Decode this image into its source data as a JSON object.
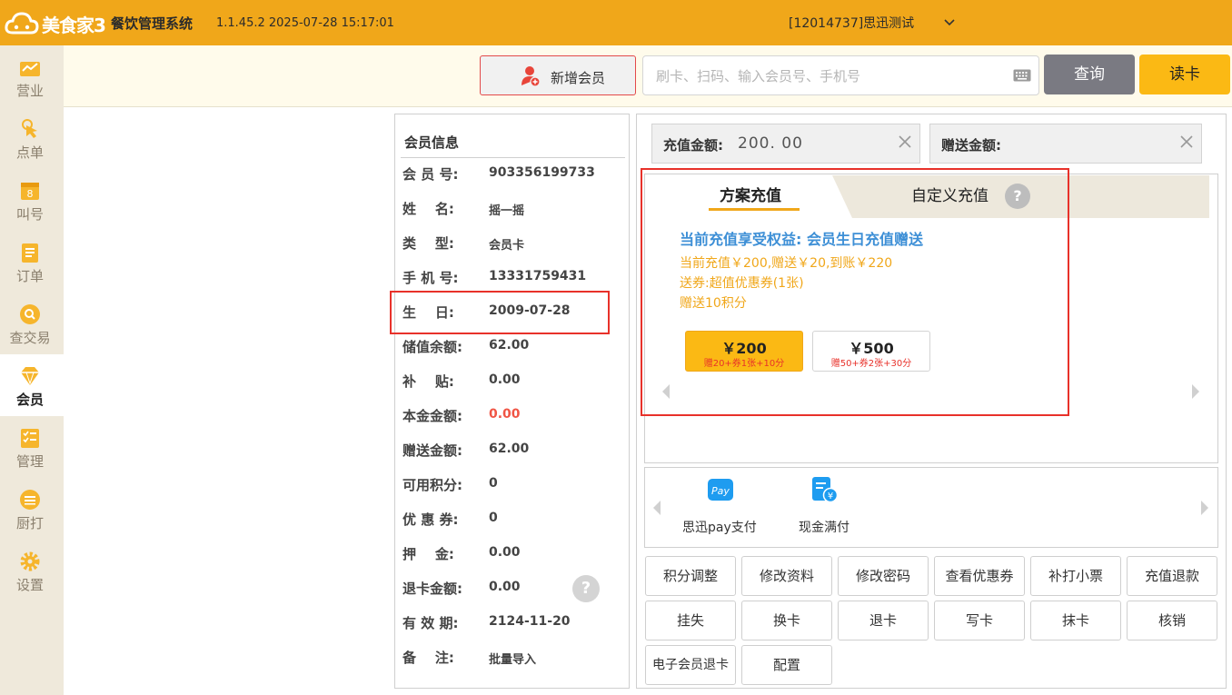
{
  "app": {
    "logo_text": "美食家3",
    "title": "餐饮管理系统",
    "version_time": "1.1.45.2 2025-07-28 15:17:01",
    "store": "[12014737]思迅测试"
  },
  "sidebar": {
    "items": [
      {
        "label": "营业",
        "icon": "chart-icon"
      },
      {
        "label": "点单",
        "icon": "tap-icon"
      },
      {
        "label": "叫号",
        "icon": "number-icon"
      },
      {
        "label": "订单",
        "icon": "order-list-icon"
      },
      {
        "label": "查交易",
        "icon": "search-icon"
      },
      {
        "label": "会员",
        "icon": "diamond-icon",
        "active": true
      },
      {
        "label": "管理",
        "icon": "checklist-icon"
      },
      {
        "label": "厨打",
        "icon": "kitchen-print-icon"
      },
      {
        "label": "设置",
        "icon": "gear-icon"
      }
    ]
  },
  "toolbar": {
    "add_member": "新增会员",
    "search_placeholder": "刷卡、扫码、输入会员号、手机号",
    "query": "查询",
    "read_card": "读卡"
  },
  "member_info": {
    "title": "会员信息",
    "rows": [
      {
        "k": "会 员 号:",
        "v": "903356199733"
      },
      {
        "k": "姓    名:",
        "v": "摇一摇"
      },
      {
        "k": "类    型:",
        "v": "会员卡"
      },
      {
        "k": "手 机 号:",
        "v": "13331759431"
      },
      {
        "k": "生    日:",
        "v": "2009-07-28"
      },
      {
        "k": "储值余额:",
        "v": "62.00"
      },
      {
        "k": "补    贴:",
        "v": "0.00"
      },
      {
        "k": "本金金额:",
        "v": "0.00"
      },
      {
        "k": "赠送金额:",
        "v": "62.00"
      },
      {
        "k": "可用积分:",
        "v": "0"
      },
      {
        "k": "优 惠 券:",
        "v": "0"
      },
      {
        "k": "押    金:",
        "v": "0.00"
      },
      {
        "k": "退卡金额:",
        "v": "0.00"
      },
      {
        "k": "有 效 期:",
        "v": "2124-11-20"
      },
      {
        "k": "备    注:",
        "v": "批量导入"
      }
    ],
    "help": "?"
  },
  "recharge": {
    "amount_label": "充值金额:",
    "amount_value": "200. 00",
    "gift_label": "赠送金额:",
    "gift_value": "",
    "tab_plan": "方案充值",
    "tab_custom": "自定义充值",
    "help": "?",
    "benefit_title": "当前充值享受权益:  会员生日充值赠送",
    "benefit_lines": [
      "当前充值￥200,赠送￥20,到账￥220",
      "送券:超值优惠券(1张)",
      "赠送10积分"
    ],
    "plans": [
      {
        "amount": "￥200",
        "gift": "赠20+券1张+10分",
        "selected": true
      },
      {
        "amount": "￥500",
        "gift": "赠50+券2张+30分",
        "selected": false
      }
    ]
  },
  "payments": [
    {
      "label": "思迅pay支付",
      "icon": "pay-icon"
    },
    {
      "label": "现金满付",
      "icon": "cash-icon"
    }
  ],
  "actions": [
    "积分调整",
    "修改资料",
    "修改密码",
    "查看优惠券",
    "补打小票",
    "充值退款",
    "挂失",
    "换卡",
    "退卡",
    "写卡",
    "抹卡",
    "核销",
    "电子会员退卡",
    "配置"
  ],
  "colors": {
    "brand": "#f0a71a",
    "sidebar_bg": "#efe9db",
    "read_button": "#fbb914",
    "query_button": "#7a7a82",
    "highlight": "#e8312a",
    "benefit_title": "#3d8fd6"
  }
}
